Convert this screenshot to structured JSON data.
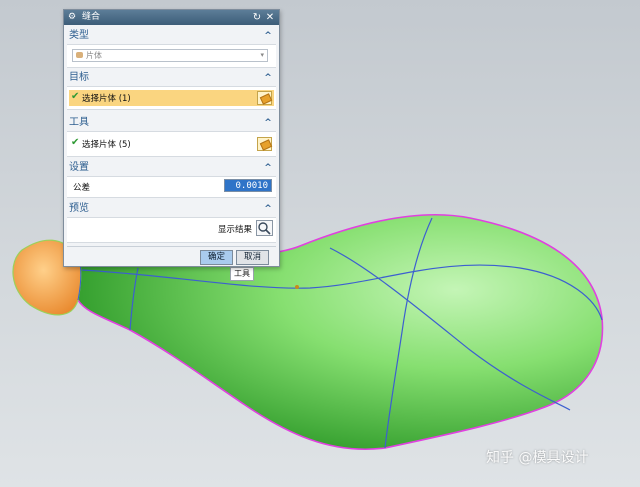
{
  "dialog": {
    "title": "缝合",
    "sections": {
      "type": {
        "header": "类型",
        "selected_value": "片体"
      },
      "target": {
        "header": "目标",
        "select_label": "选择片体 (1)"
      },
      "tool": {
        "header": "工具",
        "select_label": "选择片体 (5)"
      },
      "settings": {
        "header": "设置",
        "tolerance_label": "公差",
        "tolerance_value": "0.0010"
      },
      "preview": {
        "header": "预览",
        "show_result_label": "显示结果"
      }
    },
    "buttons": {
      "ok": "确定",
      "cancel": "取消"
    },
    "title_icons": [
      "gear-icon",
      "reset-icon",
      "close-icon"
    ],
    "section_icons": [
      "collapse-caret-icon"
    ],
    "selection_icons": [
      "check-icon",
      "eraser-select-icon"
    ]
  },
  "viewport": {
    "tool_label": "工具",
    "watermark": "知乎 @模具设计",
    "colors": {
      "surface_green": "#8fe07c",
      "surface_orange": "#f7a94a",
      "boundary_magenta": "#e040e0",
      "seam_blue": "#3c5fd0",
      "active_row": "#fad580",
      "title_bar": "#4a6c88"
    }
  }
}
